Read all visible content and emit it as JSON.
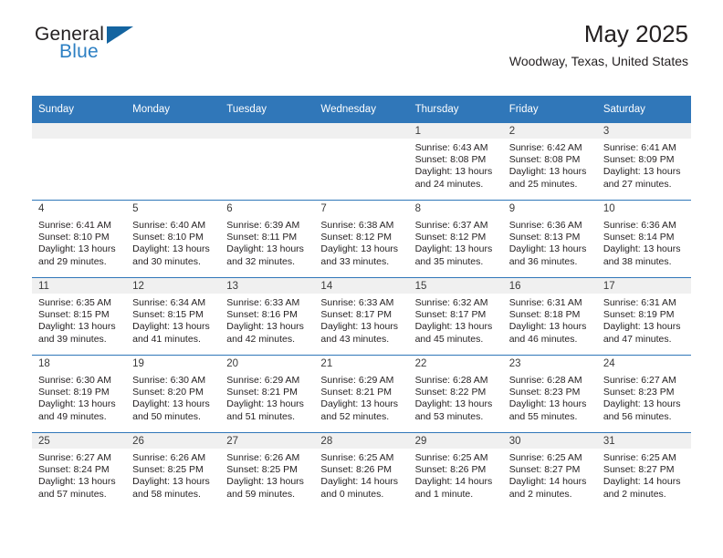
{
  "brand": {
    "name_top": "General",
    "name_bottom": "Blue",
    "flag_icon": "triangle-flag-icon",
    "accent_color": "#2c7fc3"
  },
  "header": {
    "month_title": "May 2025",
    "location": "Woodway, Texas, United States"
  },
  "calendar": {
    "header_background": "#3077b9",
    "weekday_headers": [
      "Sunday",
      "Monday",
      "Tuesday",
      "Wednesday",
      "Thursday",
      "Friday",
      "Saturday"
    ],
    "weeks": [
      [
        {
          "day": "",
          "lines": []
        },
        {
          "day": "",
          "lines": []
        },
        {
          "day": "",
          "lines": []
        },
        {
          "day": "",
          "lines": []
        },
        {
          "day": "1",
          "lines": [
            "Sunrise: 6:43 AM",
            "Sunset: 8:08 PM",
            "Daylight: 13 hours",
            "and 24 minutes."
          ]
        },
        {
          "day": "2",
          "lines": [
            "Sunrise: 6:42 AM",
            "Sunset: 8:08 PM",
            "Daylight: 13 hours",
            "and 25 minutes."
          ]
        },
        {
          "day": "3",
          "lines": [
            "Sunrise: 6:41 AM",
            "Sunset: 8:09 PM",
            "Daylight: 13 hours",
            "and 27 minutes."
          ]
        }
      ],
      [
        {
          "day": "4",
          "lines": [
            "Sunrise: 6:41 AM",
            "Sunset: 8:10 PM",
            "Daylight: 13 hours",
            "and 29 minutes."
          ]
        },
        {
          "day": "5",
          "lines": [
            "Sunrise: 6:40 AM",
            "Sunset: 8:10 PM",
            "Daylight: 13 hours",
            "and 30 minutes."
          ]
        },
        {
          "day": "6",
          "lines": [
            "Sunrise: 6:39 AM",
            "Sunset: 8:11 PM",
            "Daylight: 13 hours",
            "and 32 minutes."
          ]
        },
        {
          "day": "7",
          "lines": [
            "Sunrise: 6:38 AM",
            "Sunset: 8:12 PM",
            "Daylight: 13 hours",
            "and 33 minutes."
          ]
        },
        {
          "day": "8",
          "lines": [
            "Sunrise: 6:37 AM",
            "Sunset: 8:12 PM",
            "Daylight: 13 hours",
            "and 35 minutes."
          ]
        },
        {
          "day": "9",
          "lines": [
            "Sunrise: 6:36 AM",
            "Sunset: 8:13 PM",
            "Daylight: 13 hours",
            "and 36 minutes."
          ]
        },
        {
          "day": "10",
          "lines": [
            "Sunrise: 6:36 AM",
            "Sunset: 8:14 PM",
            "Daylight: 13 hours",
            "and 38 minutes."
          ]
        }
      ],
      [
        {
          "day": "11",
          "lines": [
            "Sunrise: 6:35 AM",
            "Sunset: 8:15 PM",
            "Daylight: 13 hours",
            "and 39 minutes."
          ]
        },
        {
          "day": "12",
          "lines": [
            "Sunrise: 6:34 AM",
            "Sunset: 8:15 PM",
            "Daylight: 13 hours",
            "and 41 minutes."
          ]
        },
        {
          "day": "13",
          "lines": [
            "Sunrise: 6:33 AM",
            "Sunset: 8:16 PM",
            "Daylight: 13 hours",
            "and 42 minutes."
          ]
        },
        {
          "day": "14",
          "lines": [
            "Sunrise: 6:33 AM",
            "Sunset: 8:17 PM",
            "Daylight: 13 hours",
            "and 43 minutes."
          ]
        },
        {
          "day": "15",
          "lines": [
            "Sunrise: 6:32 AM",
            "Sunset: 8:17 PM",
            "Daylight: 13 hours",
            "and 45 minutes."
          ]
        },
        {
          "day": "16",
          "lines": [
            "Sunrise: 6:31 AM",
            "Sunset: 8:18 PM",
            "Daylight: 13 hours",
            "and 46 minutes."
          ]
        },
        {
          "day": "17",
          "lines": [
            "Sunrise: 6:31 AM",
            "Sunset: 8:19 PM",
            "Daylight: 13 hours",
            "and 47 minutes."
          ]
        }
      ],
      [
        {
          "day": "18",
          "lines": [
            "Sunrise: 6:30 AM",
            "Sunset: 8:19 PM",
            "Daylight: 13 hours",
            "and 49 minutes."
          ]
        },
        {
          "day": "19",
          "lines": [
            "Sunrise: 6:30 AM",
            "Sunset: 8:20 PM",
            "Daylight: 13 hours",
            "and 50 minutes."
          ]
        },
        {
          "day": "20",
          "lines": [
            "Sunrise: 6:29 AM",
            "Sunset: 8:21 PM",
            "Daylight: 13 hours",
            "and 51 minutes."
          ]
        },
        {
          "day": "21",
          "lines": [
            "Sunrise: 6:29 AM",
            "Sunset: 8:21 PM",
            "Daylight: 13 hours",
            "and 52 minutes."
          ]
        },
        {
          "day": "22",
          "lines": [
            "Sunrise: 6:28 AM",
            "Sunset: 8:22 PM",
            "Daylight: 13 hours",
            "and 53 minutes."
          ]
        },
        {
          "day": "23",
          "lines": [
            "Sunrise: 6:28 AM",
            "Sunset: 8:23 PM",
            "Daylight: 13 hours",
            "and 55 minutes."
          ]
        },
        {
          "day": "24",
          "lines": [
            "Sunrise: 6:27 AM",
            "Sunset: 8:23 PM",
            "Daylight: 13 hours",
            "and 56 minutes."
          ]
        }
      ],
      [
        {
          "day": "25",
          "lines": [
            "Sunrise: 6:27 AM",
            "Sunset: 8:24 PM",
            "Daylight: 13 hours",
            "and 57 minutes."
          ]
        },
        {
          "day": "26",
          "lines": [
            "Sunrise: 6:26 AM",
            "Sunset: 8:25 PM",
            "Daylight: 13 hours",
            "and 58 minutes."
          ]
        },
        {
          "day": "27",
          "lines": [
            "Sunrise: 6:26 AM",
            "Sunset: 8:25 PM",
            "Daylight: 13 hours",
            "and 59 minutes."
          ]
        },
        {
          "day": "28",
          "lines": [
            "Sunrise: 6:25 AM",
            "Sunset: 8:26 PM",
            "Daylight: 14 hours",
            "and 0 minutes."
          ]
        },
        {
          "day": "29",
          "lines": [
            "Sunrise: 6:25 AM",
            "Sunset: 8:26 PM",
            "Daylight: 14 hours",
            "and 1 minute."
          ]
        },
        {
          "day": "30",
          "lines": [
            "Sunrise: 6:25 AM",
            "Sunset: 8:27 PM",
            "Daylight: 14 hours",
            "and 2 minutes."
          ]
        },
        {
          "day": "31",
          "lines": [
            "Sunrise: 6:25 AM",
            "Sunset: 8:27 PM",
            "Daylight: 14 hours",
            "and 2 minutes."
          ]
        }
      ]
    ]
  }
}
